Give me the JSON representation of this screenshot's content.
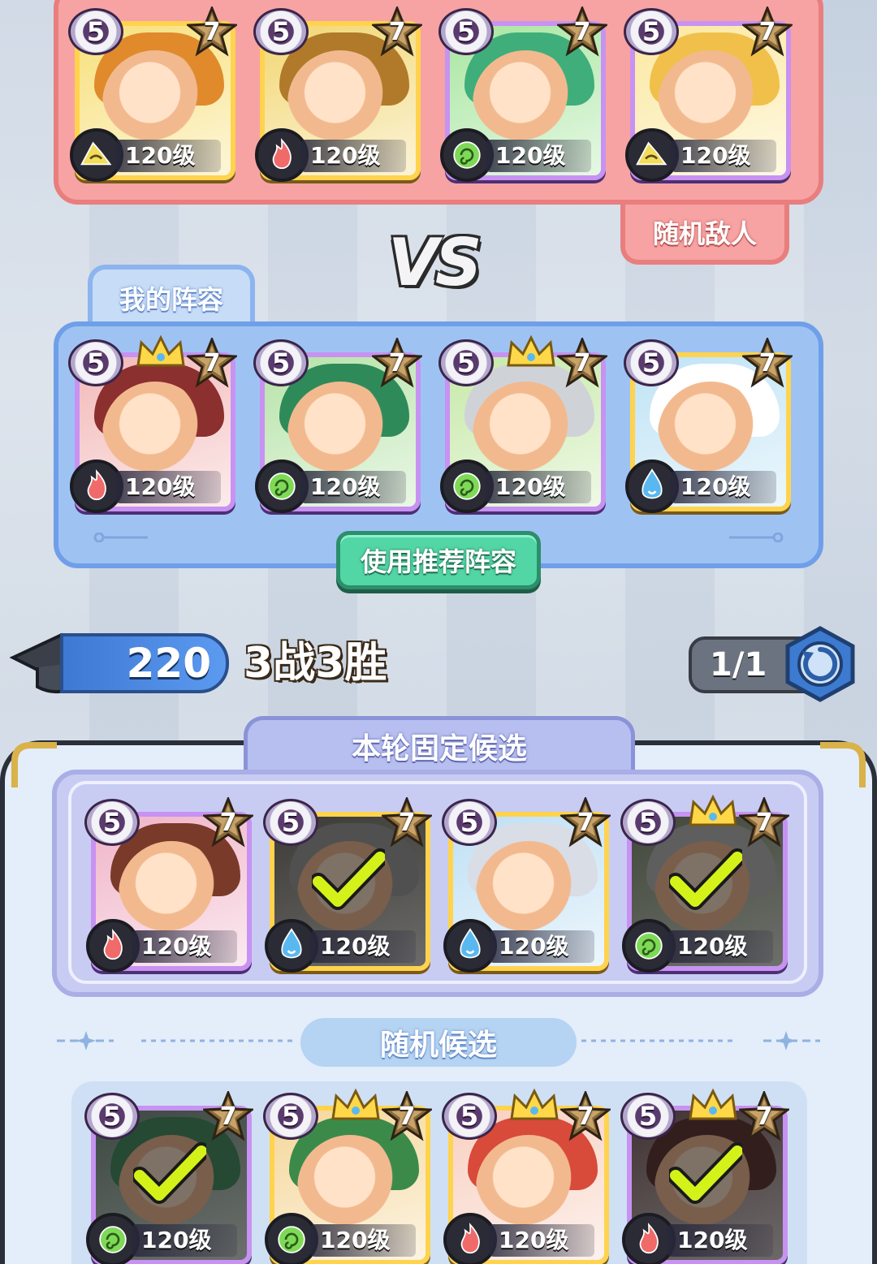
{
  "enemy": {
    "tag": "随机敌人",
    "heroes": [
      {
        "stars": "5",
        "rank": "7",
        "level": "120级",
        "element": "earth",
        "frame": "gold",
        "crown": false
      },
      {
        "stars": "5",
        "rank": "7",
        "level": "120级",
        "element": "fire",
        "frame": "gold",
        "crown": false
      },
      {
        "stars": "5",
        "rank": "7",
        "level": "120级",
        "element": "wind",
        "frame": "purple",
        "crown": false
      },
      {
        "stars": "5",
        "rank": "7",
        "level": "120级",
        "element": "earth",
        "frame": "purple",
        "crown": false
      }
    ]
  },
  "vs_label": "VS",
  "my_lineup": {
    "tab": "我的阵容",
    "recommend_button": "使用推荐阵容",
    "heroes": [
      {
        "stars": "5",
        "rank": "7",
        "level": "120级",
        "element": "fire",
        "frame": "purple",
        "crown": true
      },
      {
        "stars": "5",
        "rank": "7",
        "level": "120级",
        "element": "wind",
        "frame": "purple",
        "crown": false
      },
      {
        "stars": "5",
        "rank": "7",
        "level": "120级",
        "element": "wind",
        "frame": "purple",
        "crown": true
      },
      {
        "stars": "5",
        "rank": "7",
        "level": "120级",
        "element": "water",
        "frame": "gold",
        "crown": false
      }
    ]
  },
  "status": {
    "score": "220",
    "record": "3战3胜",
    "refresh_count": "1/1"
  },
  "fixed_candidates": {
    "tab": "本轮固定候选",
    "heroes": [
      {
        "stars": "5",
        "rank": "7",
        "level": "120级",
        "element": "fire",
        "frame": "purple",
        "crown": false,
        "selected": false
      },
      {
        "stars": "5",
        "rank": "7",
        "level": "120级",
        "element": "water",
        "frame": "gold",
        "crown": false,
        "selected": true
      },
      {
        "stars": "5",
        "rank": "7",
        "level": "120级",
        "element": "water",
        "frame": "gold",
        "crown": false,
        "selected": false
      },
      {
        "stars": "5",
        "rank": "7",
        "level": "120级",
        "element": "wind",
        "frame": "purple",
        "crown": true,
        "selected": true
      }
    ]
  },
  "random_candidates": {
    "tab": "随机候选",
    "heroes": [
      {
        "stars": "5",
        "rank": "7",
        "level": "120级",
        "element": "wind",
        "frame": "purple",
        "crown": false,
        "selected": true
      },
      {
        "stars": "5",
        "rank": "7",
        "level": "120级",
        "element": "wind",
        "frame": "gold",
        "crown": true,
        "selected": false
      },
      {
        "stars": "5",
        "rank": "7",
        "level": "120级",
        "element": "fire",
        "frame": "gold",
        "crown": true,
        "selected": false
      },
      {
        "stars": "5",
        "rank": "7",
        "level": "120级",
        "element": "fire",
        "frame": "purple",
        "crown": true,
        "selected": true
      }
    ]
  },
  "colors": {
    "enemy_panel": "#f7a3a3",
    "my_panel": "#9ec3f3",
    "recommend_button": "#53d6a5",
    "score_bar": "#4a88e0",
    "check": "#d4f21a",
    "element_fire": "#f06a6a",
    "element_wind": "#7ed957",
    "element_water": "#5ab8f0",
    "element_earth": "#f2dc5a"
  }
}
